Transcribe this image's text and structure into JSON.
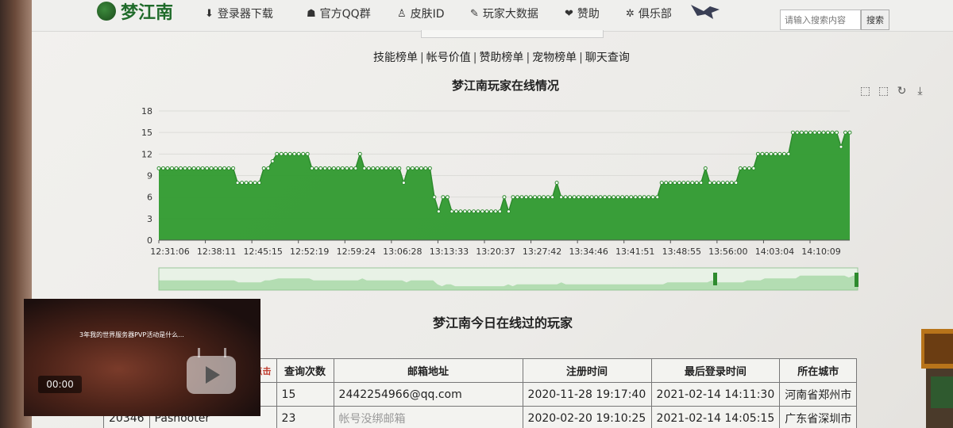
{
  "nav": {
    "brand": "梦江南",
    "items": [
      {
        "icon": "download-icon",
        "glyph": "⬇",
        "label": "登录器下载"
      },
      {
        "icon": "qq-icon",
        "glyph": "☗",
        "label": "官方QQ群"
      },
      {
        "icon": "person-icon",
        "glyph": "♙",
        "label": "皮肤ID"
      },
      {
        "icon": "wrench-icon",
        "glyph": "✎",
        "label": "玩家大数据"
      },
      {
        "icon": "heartbeat-icon",
        "glyph": "❤",
        "label": "赞助"
      },
      {
        "icon": "group-icon",
        "glyph": "✲",
        "label": "俱乐部"
      }
    ],
    "search_placeholder": "请输入搜索内容",
    "search_button": "搜索"
  },
  "sublinks": [
    "技能榜单",
    "帐号价值",
    "赞助榜单",
    "宠物榜单",
    "聊天查询"
  ],
  "chart_data": {
    "type": "area",
    "title": "梦江南玩家在线情况",
    "x_ticks": [
      "12:31:06",
      "12:38:11",
      "12:45:15",
      "12:52:19",
      "12:59:24",
      "13:06:28",
      "13:13:33",
      "13:20:37",
      "13:27:42",
      "13:34:46",
      "13:41:51",
      "13:48:55",
      "13:56:00",
      "14:03:04",
      "14:10:09"
    ],
    "ylim": [
      0,
      18
    ],
    "y_ticks": [
      0,
      3,
      6,
      9,
      12,
      15,
      18
    ],
    "values": [
      10,
      10,
      10,
      10,
      10,
      10,
      10,
      10,
      10,
      10,
      10,
      10,
      10,
      10,
      10,
      10,
      10,
      10,
      8,
      8,
      8,
      8,
      8,
      8,
      10,
      10,
      11,
      12,
      12,
      12,
      12,
      12,
      12,
      12,
      12,
      10,
      10,
      10,
      10,
      10,
      10,
      10,
      10,
      10,
      10,
      10,
      12,
      10,
      10,
      10,
      10,
      10,
      10,
      10,
      10,
      10,
      8,
      10,
      10,
      10,
      10,
      10,
      10,
      6,
      4,
      6,
      6,
      4,
      4,
      4,
      4,
      4,
      4,
      4,
      4,
      4,
      4,
      4,
      4,
      6,
      4,
      6,
      6,
      6,
      6,
      6,
      6,
      6,
      6,
      6,
      6,
      8,
      6,
      6,
      6,
      6,
      6,
      6,
      6,
      6,
      6,
      6,
      6,
      6,
      6,
      6,
      6,
      6,
      6,
      6,
      6,
      6,
      6,
      6,
      6,
      8,
      8,
      8,
      8,
      8,
      8,
      8,
      8,
      8,
      8,
      10,
      8,
      8,
      8,
      8,
      8,
      8,
      8,
      10,
      10,
      10,
      10,
      12,
      12,
      12,
      12,
      12,
      12,
      12,
      12,
      15,
      15,
      15,
      15,
      15,
      15,
      15,
      15,
      15,
      15,
      15,
      13,
      15,
      15
    ],
    "grid": true,
    "toolbox": [
      "zoom-icon",
      "zoom-reset-icon",
      "restore-icon",
      "save-image-icon"
    ],
    "colors": {
      "line": "#2e8b2e",
      "fill": "#2f9a2f",
      "zoom_bar": "#8fcf8f"
    }
  },
  "section_title": "梦江南今日在线过的玩家",
  "table": {
    "headers": [
      "点击",
      "查询次数",
      "邮箱地址",
      "注册时间",
      "最后登录时间",
      "所在城市"
    ],
    "rows": [
      [
        "",
        "",
        "15",
        "2442254966@qq.com",
        "2020-11-28 19:17:40",
        "2021-02-14 14:11:30",
        "河南省郑州市"
      ],
      [
        "20346",
        "Pashooter",
        "23",
        "帐号没绑邮箱",
        "2020-02-20 19:10:25",
        "2021-02-14 14:05:15",
        "广东省深圳市"
      ]
    ]
  },
  "video": {
    "title": "3年我的世界服务器PVP活动是什么...",
    "time": "00:00"
  }
}
